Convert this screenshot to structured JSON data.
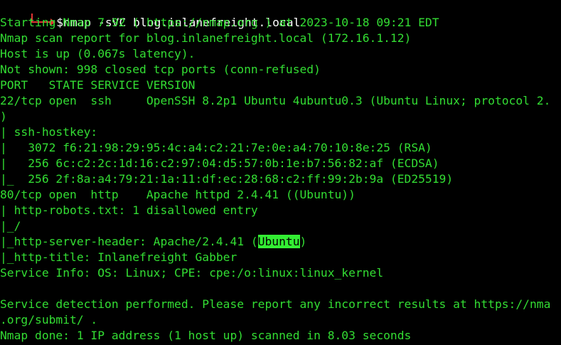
{
  "colors": {
    "background": "#000000",
    "output_text": "#33dd33",
    "command_text": "#ffffff",
    "prompt_glyph": "#e23434",
    "highlight_bg": "#33ee33"
  },
  "prompt": {
    "icon": "prompt-arrow-icon",
    "command": "$nmap -sVC blog.inlanefreight.local"
  },
  "output": {
    "line1": "Starting Nmap 7.92 ( https://nmap.org ) at 2023-10-18 09:21 EDT",
    "line2": "Nmap scan report for blog.inlanefreight.local (172.16.1.12)",
    "line3": "Host is up (0.067s latency).",
    "line4": "Not shown: 998 closed tcp ports (conn-refused)",
    "line5": "PORT   STATE SERVICE VERSION",
    "line6": "22/tcp open  ssh     OpenSSH 8.2p1 Ubuntu 4ubuntu0.3 (Ubuntu Linux; protocol 2.",
    "line7": ")",
    "line8": "| ssh-hostkey: ",
    "line9": "|   3072 f6:21:98:29:95:4c:a4:c2:21:7e:0e:a4:70:10:8e:25 (RSA)",
    "line10": "|   256 6c:c2:2c:1d:16:c2:97:04:d5:57:0b:1e:b7:56:82:af (ECDSA)",
    "line11": "|_  256 2f:8a:a4:79:21:1a:11:df:ec:28:68:c2:ff:99:2b:9a (ED25519)",
    "line12": "80/tcp open  http    Apache httpd 2.4.41 ((Ubuntu))",
    "line13": "| http-robots.txt: 1 disallowed entry ",
    "line14": "|_/",
    "line15_before": "|_http-server-header: Apache/2.4.41 (",
    "line15_highlight": "Ubuntu",
    "line15_after": ")",
    "line16": "|_http-title: Inlanefreight Gabber",
    "line17": "Service Info: OS: Linux; CPE: cpe:/o:linux:linux_kernel",
    "line18": "",
    "line19": "Service detection performed. Please report any incorrect results at https://nma",
    "line20": ".org/submit/ .",
    "line21": "Nmap done: 1 IP address (1 host up) scanned in 8.03 seconds"
  }
}
